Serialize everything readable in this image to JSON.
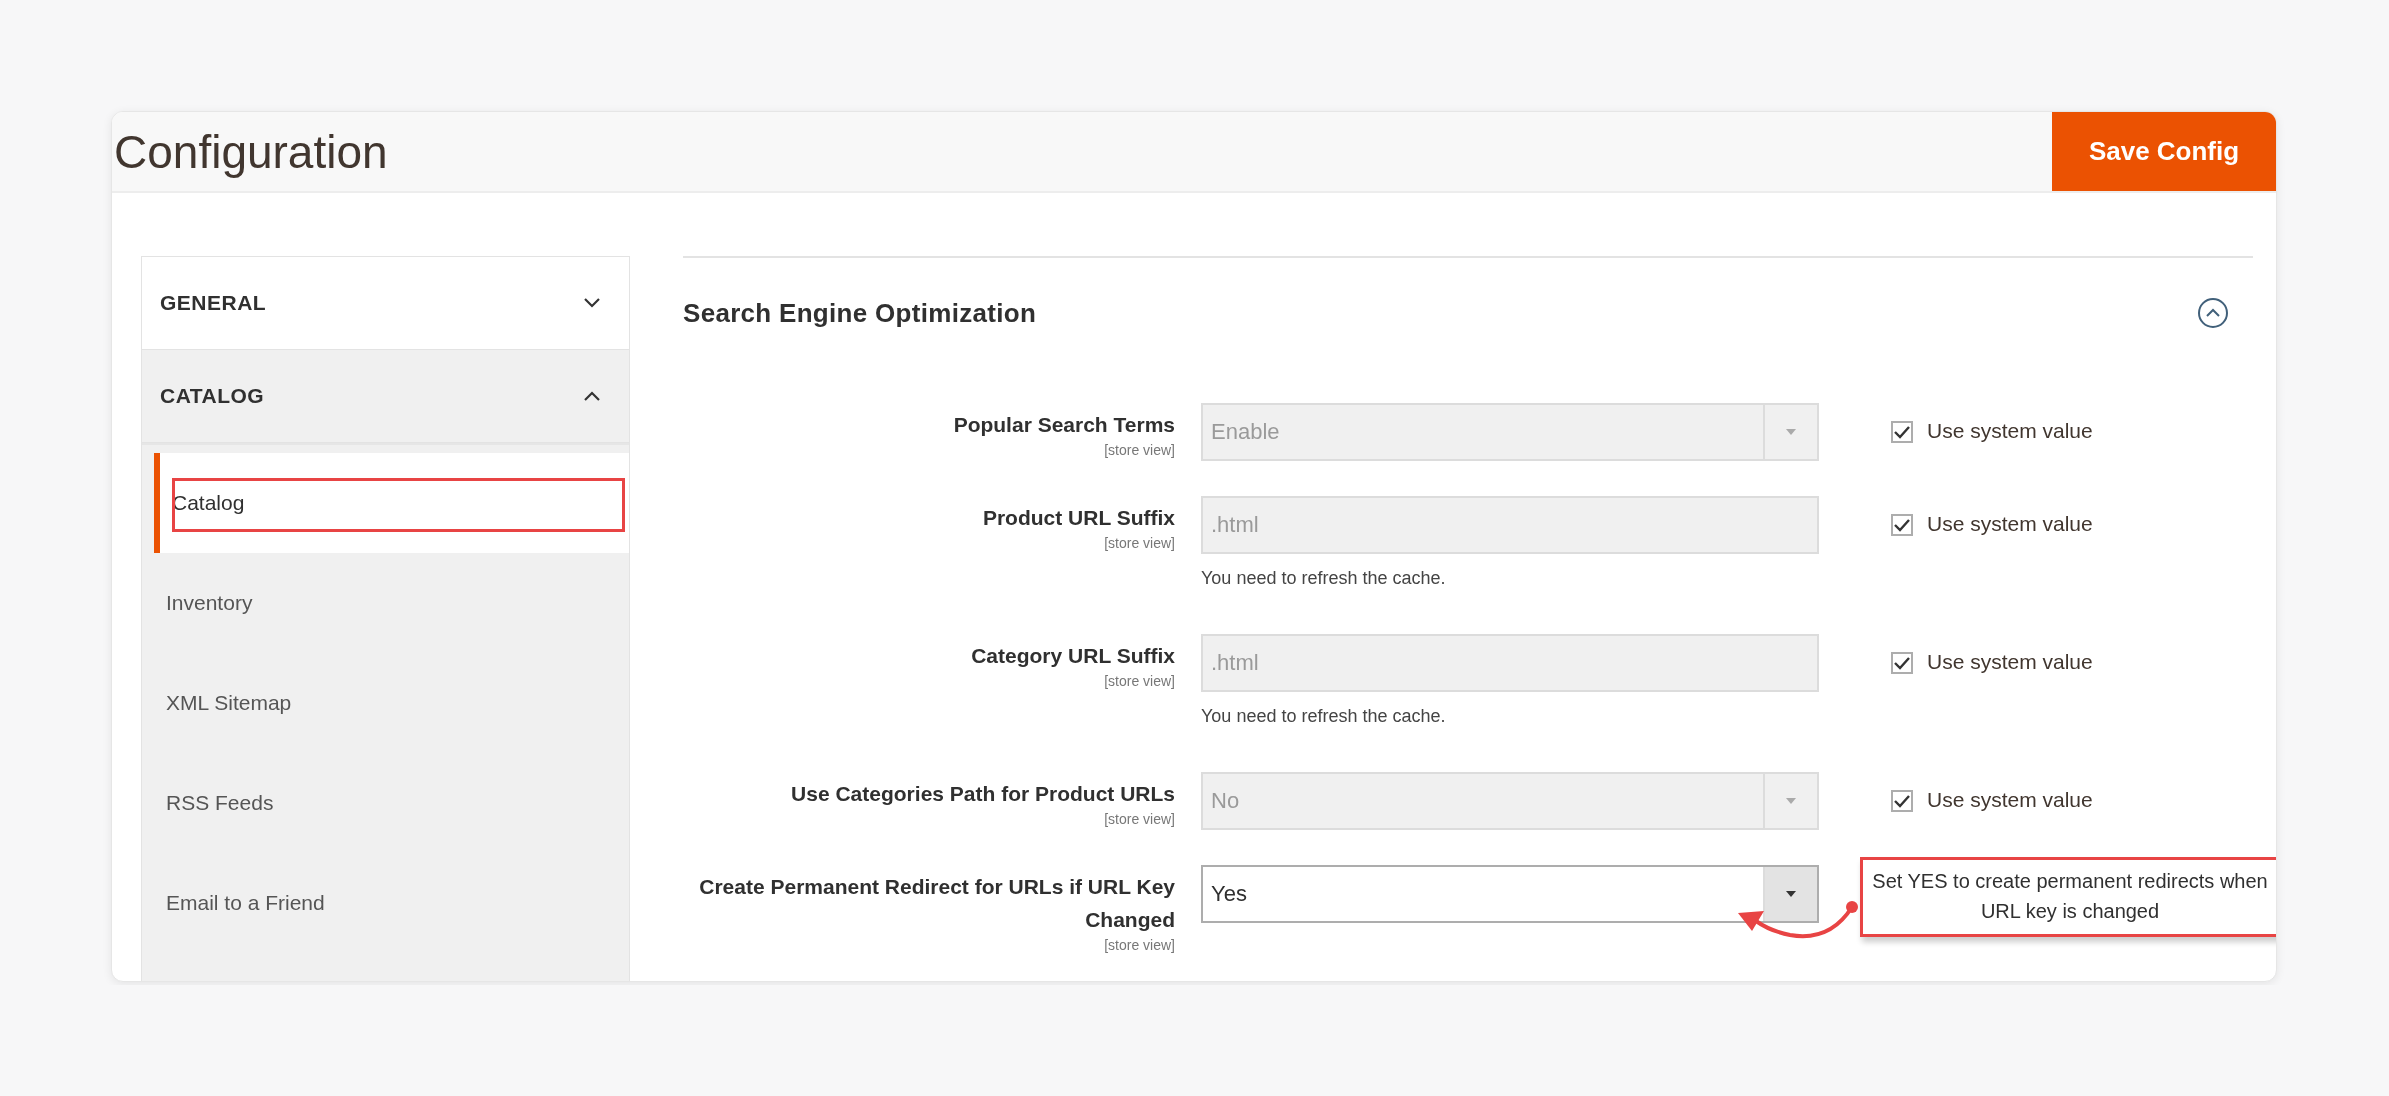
{
  "page": {
    "title": "Configuration",
    "save_button": "Save Config"
  },
  "sidebar": {
    "groups": [
      {
        "label": "GENERAL",
        "expanded": false
      },
      {
        "label": "CATALOG",
        "expanded": true,
        "children": [
          {
            "label": "Catalog",
            "selected": true,
            "highlighted": true
          },
          {
            "label": "Inventory",
            "selected": false,
            "highlighted": false
          },
          {
            "label": "XML Sitemap",
            "selected": false,
            "highlighted": false
          },
          {
            "label": "RSS Feeds",
            "selected": false,
            "highlighted": false
          },
          {
            "label": "Email to a Friend",
            "selected": false,
            "highlighted": false
          }
        ]
      }
    ]
  },
  "section": {
    "title": "Search Engine Optimization",
    "expanded": true,
    "fields": [
      {
        "kind": "select",
        "label": "Popular Search Terms",
        "scope": "[store view]",
        "value": "Enable",
        "disabled": true,
        "use_system_value": {
          "label": "Use system value",
          "checked": true
        }
      },
      {
        "kind": "text",
        "label": "Product URL Suffix",
        "scope": "[store view]",
        "value": ".html",
        "disabled": true,
        "note": "You need to refresh the cache.",
        "use_system_value": {
          "label": "Use system value",
          "checked": true
        }
      },
      {
        "kind": "text",
        "label": "Category URL Suffix",
        "scope": "[store view]",
        "value": ".html",
        "disabled": true,
        "note": "You need to refresh the cache.",
        "use_system_value": {
          "label": "Use system value",
          "checked": true
        }
      },
      {
        "kind": "select",
        "label": "Use Categories Path for Product URLs",
        "scope": "[store view]",
        "value": "No",
        "disabled": true,
        "use_system_value": {
          "label": "Use system value",
          "checked": true
        }
      },
      {
        "kind": "select",
        "label": "Create Permanent Redirect for URLs if URL Key Changed",
        "scope": "[store view]",
        "value": "Yes",
        "disabled": false,
        "callout": "Set YES to create permanent redirects when URL key is changed"
      }
    ]
  }
}
